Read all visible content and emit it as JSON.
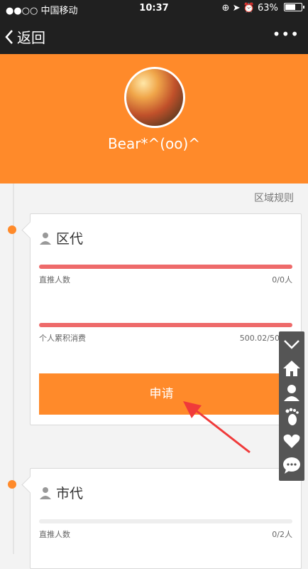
{
  "status_bar": {
    "carrier": "●●○○ 中国移动",
    "time": "10:37",
    "battery": "63%",
    "battery_level": 0.63
  },
  "nav": {
    "back_label": "返回",
    "more_label": "•••"
  },
  "profile": {
    "username": "Bear*^(oo)^"
  },
  "rules_label": "区域规则",
  "cards": [
    {
      "title": "区代",
      "metric1_label": "直推人数",
      "metric1_value": "0/0人",
      "metric2_label": "个人累积消费",
      "metric2_value": "500.02/500元",
      "apply_label": "申请"
    },
    {
      "title": "市代",
      "metric1_label": "直推人数",
      "metric1_value": "0/2人"
    }
  ],
  "colors": {
    "accent": "#ff8a2a",
    "progress_red": "#ee6a6a",
    "nav_bg": "#202020"
  }
}
